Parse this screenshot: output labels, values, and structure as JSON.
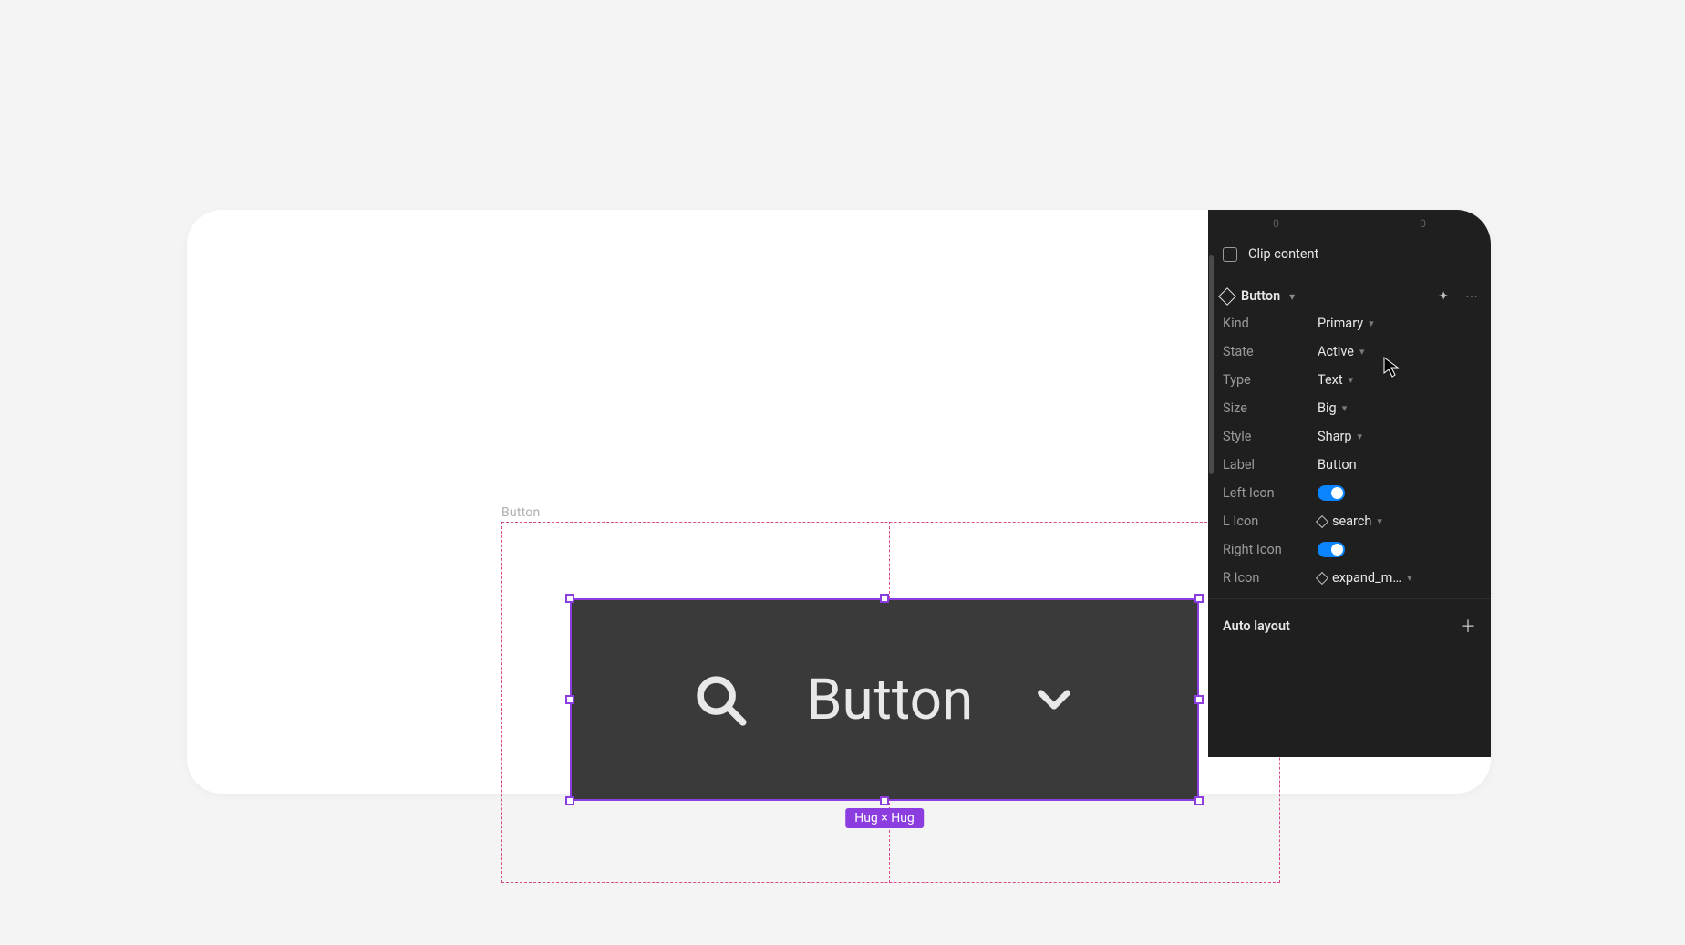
{
  "canvas": {
    "frame_label": "Button",
    "button_label": "Button",
    "size_badge": "Hug × Hug"
  },
  "panel": {
    "top_values": [
      "0",
      "0"
    ],
    "clip_content_label": "Clip content",
    "component_name": "Button",
    "props": {
      "kind": {
        "label": "Kind",
        "value": "Primary"
      },
      "state": {
        "label": "State",
        "value": "Active"
      },
      "type": {
        "label": "Type",
        "value": "Text"
      },
      "size": {
        "label": "Size",
        "value": "Big"
      },
      "style": {
        "label": "Style",
        "value": "Sharp"
      },
      "label": {
        "label": "Label",
        "value": "Button"
      },
      "left_icon_toggle": {
        "label": "Left Icon",
        "on": true
      },
      "l_icon": {
        "label": "L Icon",
        "value": "search"
      },
      "right_icon_toggle": {
        "label": "Right Icon",
        "on": true
      },
      "r_icon": {
        "label": "R Icon",
        "value": "expand_m…"
      }
    },
    "auto_layout_label": "Auto layout"
  }
}
